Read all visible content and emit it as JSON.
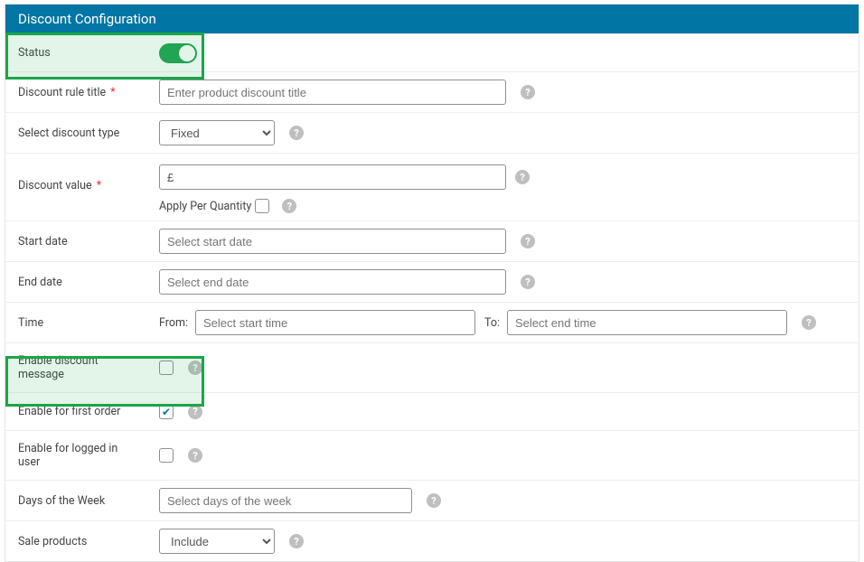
{
  "header": {
    "title": "Discount Configuration"
  },
  "rows": {
    "status": {
      "label": "Status",
      "toggle_on": true
    },
    "title": {
      "label": "Discount rule title",
      "required": "*",
      "placeholder": "Enter product discount title"
    },
    "type": {
      "label": "Select discount type",
      "value": "Fixed"
    },
    "value": {
      "label": "Discount value",
      "required": "*",
      "currency": "£",
      "apply_label": "Apply Per Quantity"
    },
    "start": {
      "label": "Start date",
      "placeholder": "Select start date"
    },
    "end": {
      "label": "End date",
      "placeholder": "Select end date"
    },
    "time": {
      "label": "Time",
      "from_lbl": "From:",
      "to_lbl": "To:",
      "from_ph": "Select start time",
      "to_ph": "Select end time"
    },
    "msg": {
      "label": "Enable discount message",
      "checked": false
    },
    "first": {
      "label": "Enable for first order",
      "checked": true
    },
    "logged": {
      "label": "Enable for logged in user",
      "checked": false
    },
    "days": {
      "label": "Days of the Week",
      "placeholder": "Select days of the week"
    },
    "sale": {
      "label": "Sale products",
      "value": "Include"
    }
  },
  "help_glyph": "?"
}
